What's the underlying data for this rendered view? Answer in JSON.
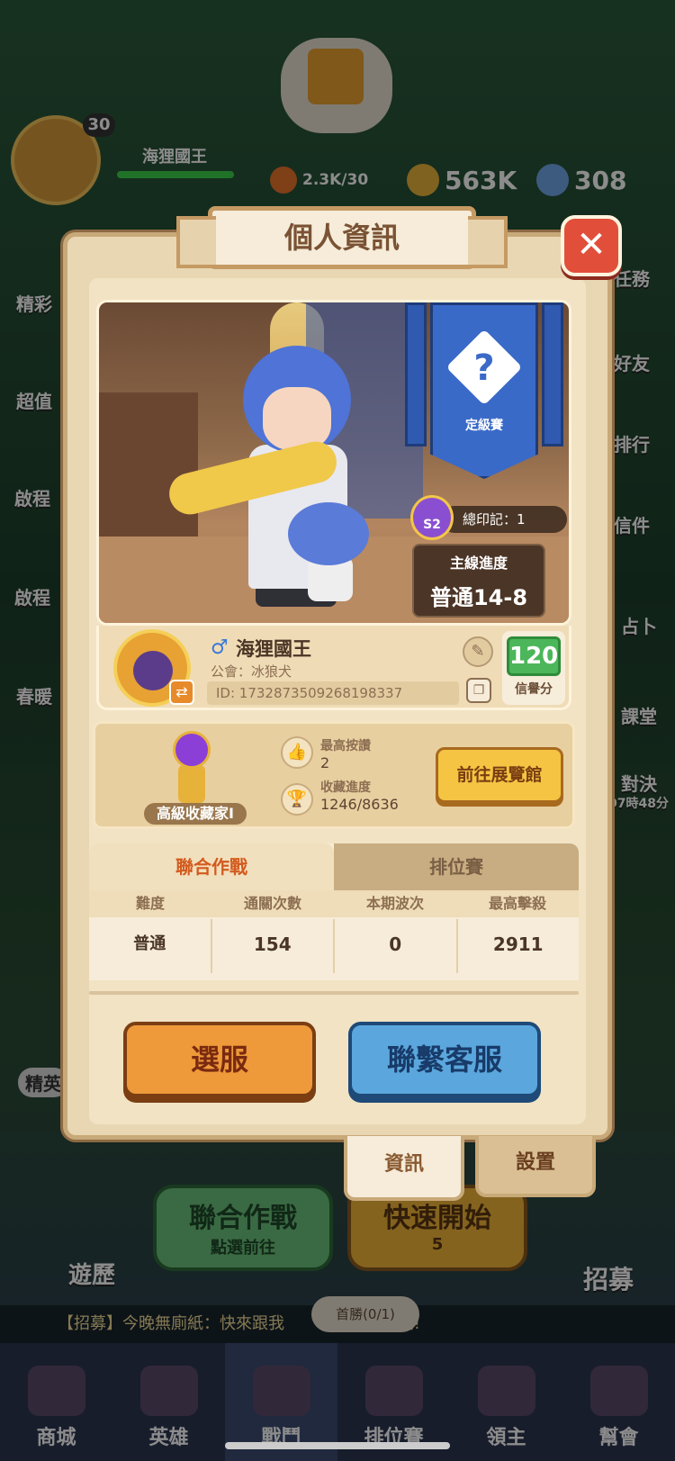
{
  "background": {
    "player_level": "30",
    "player_name": "海狸國王",
    "resources": [
      {
        "icon": "fire-icon",
        "value": "2.3K/30",
        "color": "#e7742a"
      },
      {
        "icon": "gold-coin-icon",
        "value": "563K",
        "color": "#e7b23a"
      },
      {
        "icon": "blue-flower-icon",
        "value": "308",
        "color": "#6fa4e8"
      }
    ],
    "side_left": [
      "精彩",
      "超值",
      "啟程",
      "啟程",
      "春暖"
    ],
    "side_right": [
      "任務",
      "好友",
      "排行",
      "信件",
      "占卜",
      "課堂",
      "對決",
      "07時48分"
    ],
    "bottom_buttons": {
      "coop_title": "聯合作戰",
      "coop_sub": "點選前往",
      "quick_start": "快速開始",
      "quick_cost": "5",
      "trip": "遊歷",
      "recruit": "招募",
      "elite": "精英"
    },
    "chat_text": "【招募】今晚無廁紙：快來跟我",
    "chat_suffix": "吧!",
    "first_clear": "首勝(0/1)",
    "nav": [
      "商城",
      "英雄",
      "戰鬥",
      "排位賽",
      "領主",
      "幫會"
    ],
    "nav_active": 2
  },
  "modal": {
    "title": "個人資訊",
    "close_symbol": "✕",
    "rank_label": "定級賽",
    "rank_symbol": "?",
    "seal_badge": "S2",
    "seal_text": "總印記：1",
    "progress_label": "主線進度",
    "progress_value": "普通14-8",
    "player": {
      "gender_symbol": "♂",
      "name": "海狸國王",
      "guild": "公會：冰狼犬",
      "id": "ID: 1732873509268198337",
      "credit_value": "120",
      "credit_label": "信譽分"
    },
    "collection": {
      "title": "高級收藏家I",
      "likes_label": "最高按讚",
      "likes_value": "2",
      "progress_label": "收藏進度",
      "progress_value": "1246/8636",
      "exhibit_button": "前往展覽館"
    },
    "tabs": [
      {
        "label": "聯合作戰",
        "active": true
      },
      {
        "label": "排位賽",
        "active": false
      }
    ],
    "table": {
      "headers": [
        "難度",
        "通關次數",
        "本期波次",
        "最高擊殺"
      ],
      "row": [
        "普通",
        "154",
        "0",
        "2911"
      ]
    },
    "server_button": "選服",
    "support_button": "聯繫客服",
    "bottom_tabs": [
      {
        "label": "資訊",
        "active": true
      },
      {
        "label": "設置",
        "active": false
      }
    ]
  }
}
